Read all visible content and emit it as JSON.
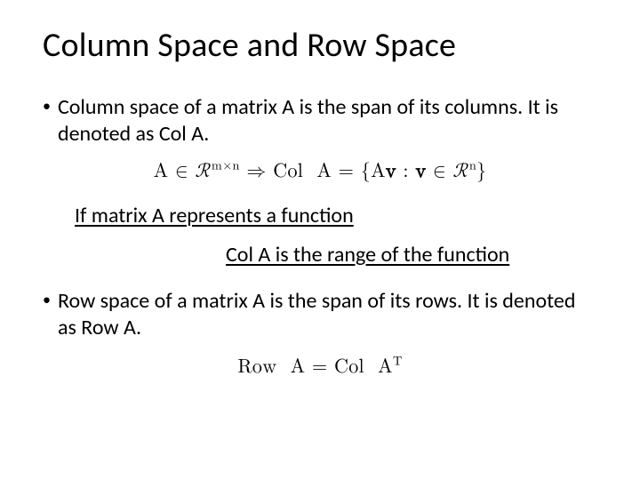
{
  "title": "Column Space and Row Space",
  "bullets": {
    "b1": "Column space of a matrix A is the span of its columns. It is denoted as Col A.",
    "b2": "Row space of a matrix A is the span of its rows. It is denoted as Row A."
  },
  "formulas": {
    "col_def_html": "A ∈ ℛ<sup>m×n</sup> ⇒ Col&nbsp; A = {A<b>v</b> : <b>v</b> ∈ ℛ<sup>n</sup>}",
    "row_def_html": "Row&nbsp; A = Col&nbsp; A<sup>T</sup>"
  },
  "callouts": {
    "c1": "If matrix A represents a function",
    "c2": "Col A is the range of the function"
  }
}
